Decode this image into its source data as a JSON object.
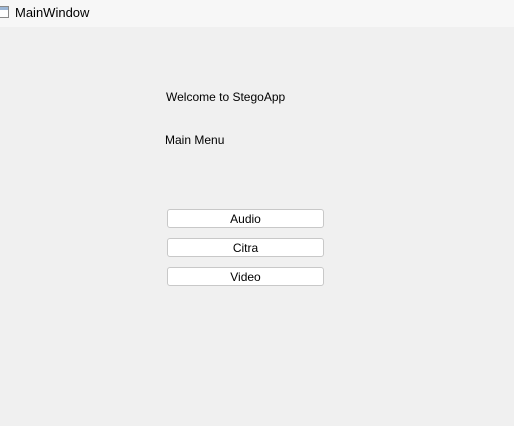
{
  "window": {
    "title": "MainWindow",
    "icon": "app-window-icon"
  },
  "content": {
    "welcome_text": "Welcome to StegoApp",
    "menu_label": "Main Menu"
  },
  "buttons": {
    "audio": "Audio",
    "citra": "Citra",
    "video": "Video"
  }
}
